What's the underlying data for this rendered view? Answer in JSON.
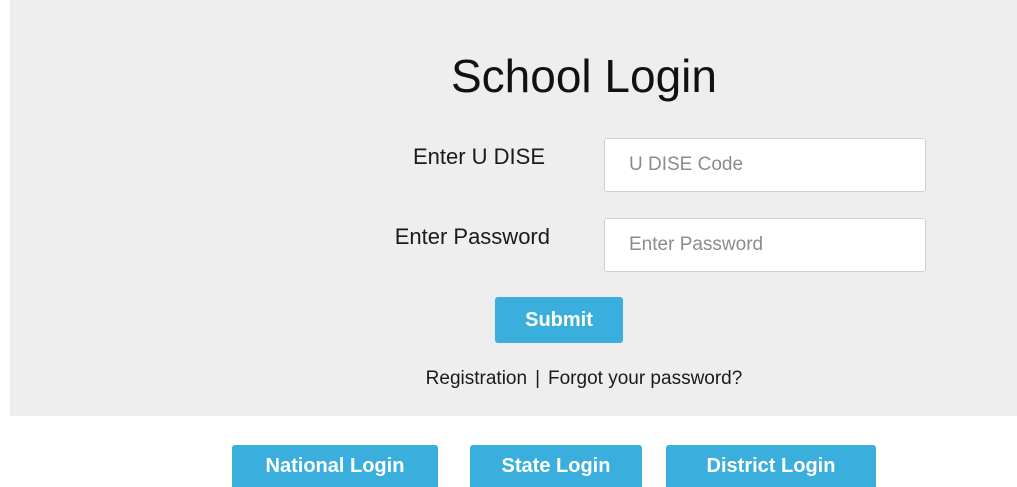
{
  "login": {
    "title": "School Login",
    "udise_label": "Enter U DISE",
    "udise_placeholder": "U DISE Code",
    "password_label": "Enter Password",
    "password_placeholder": "Enter Password",
    "submit_label": "Submit"
  },
  "links": {
    "registration": "Registration",
    "separator": "|",
    "forgot_password": "Forgot your password?"
  },
  "other_logins": {
    "national": "National Login",
    "state": "State Login",
    "district": "District Login"
  },
  "colors": {
    "panel_background": "#eeeeee",
    "button_accent": "#3aaedc"
  }
}
